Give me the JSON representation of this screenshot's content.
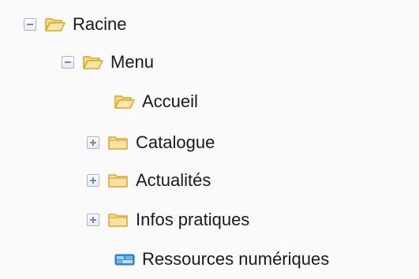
{
  "tree": {
    "root": {
      "label": "Racine",
      "icon": "folder-open-icon",
      "expanded": true
    },
    "menu": {
      "label": "Menu",
      "icon": "folder-open-icon",
      "expanded": true
    },
    "items": [
      {
        "label": "Accueil",
        "icon": "folder-open-icon",
        "expander": "none"
      },
      {
        "label": "Catalogue",
        "icon": "folder-closed-icon",
        "expander": "plus"
      },
      {
        "label": "Actualités",
        "icon": "folder-closed-icon",
        "expander": "plus"
      },
      {
        "label": "Infos pratiques",
        "icon": "folder-closed-icon",
        "expander": "plus"
      },
      {
        "label": "Ressources numériques",
        "icon": "digital-resources-icon",
        "expander": "none"
      }
    ]
  },
  "colors": {
    "folder_fill": "#f7d98a",
    "folder_stroke": "#d9a528",
    "expander_border": "#a8b6c8",
    "resource_icon": "#3a8fd8"
  }
}
